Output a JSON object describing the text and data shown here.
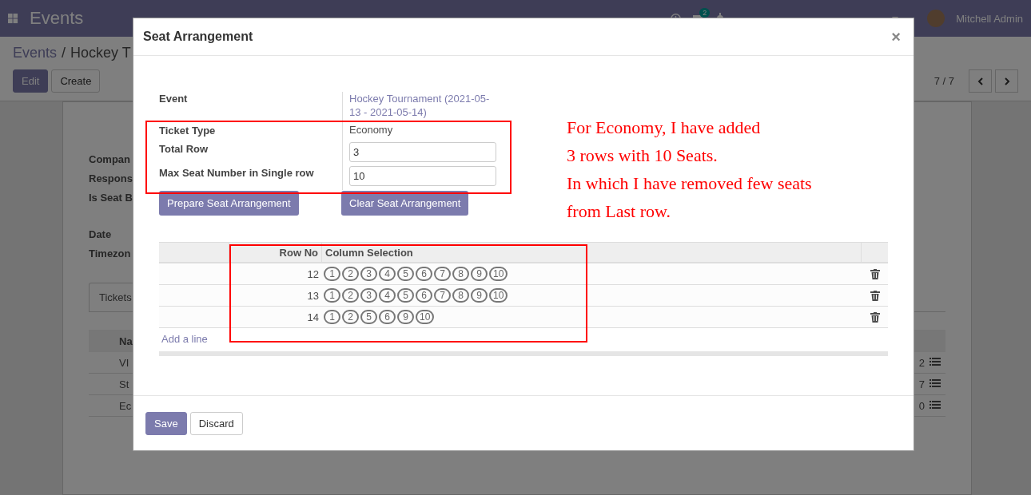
{
  "navbar": {
    "app_title": "Events",
    "chat_count": "2",
    "user": "Mitchell Admin"
  },
  "breadcrumb": [
    "Events",
    "/",
    "Hockey T"
  ],
  "buttons": [
    {
      "label": "Edit",
      "kind": "primary"
    },
    {
      "label": "Create",
      "kind": "secondary"
    }
  ],
  "pager": "7 / 7",
  "sheet": {
    "labels": [
      "Compan",
      "Respons",
      "Is Seat B",
      "Date",
      "Timezon"
    ],
    "tab": "Tickets",
    "column_1": "Na",
    "rows": [
      {
        "name": "VI",
        "count": "2"
      },
      {
        "name": "St",
        "count": "7"
      },
      {
        "name": "Ec",
        "count": "0"
      }
    ]
  },
  "dialog": {
    "title": "Seat Arrangement",
    "close": "×",
    "fields": [
      {
        "label": "Event",
        "kind": "link",
        "value": "Hockey Tournament (2021-05-13 - 2021-05-14)"
      },
      {
        "label": "Ticket Type",
        "kind": "text",
        "value": "Economy"
      },
      {
        "label": "Total Row",
        "kind": "input",
        "value": "3"
      },
      {
        "label": "Max Seat Number in Single row",
        "kind": "input",
        "value": "10"
      }
    ],
    "actions": [
      "Prepare Seat Arrangement",
      "Clear Seat Arrangement"
    ],
    "table": {
      "columns": [
        "Row No",
        "Column Selection"
      ],
      "rows": [
        {
          "row_no": "12",
          "seats": [
            "1",
            "2",
            "3",
            "4",
            "5",
            "6",
            "7",
            "8",
            "9",
            "10"
          ]
        },
        {
          "row_no": "13",
          "seats": [
            "1",
            "2",
            "3",
            "4",
            "5",
            "6",
            "7",
            "8",
            "9",
            "10"
          ]
        },
        {
          "row_no": "14",
          "seats": [
            "1",
            "2",
            "5",
            "6",
            "9",
            "10"
          ]
        }
      ],
      "add_line": "Add a line"
    },
    "footer": [
      {
        "label": "Save",
        "kind": "primary"
      },
      {
        "label": "Discard",
        "kind": "secondary"
      }
    ]
  },
  "annotation": [
    "For Economy, I have added",
    "3 rows with 10 Seats.",
    "In which I have removed few seats",
    "from Last row."
  ]
}
